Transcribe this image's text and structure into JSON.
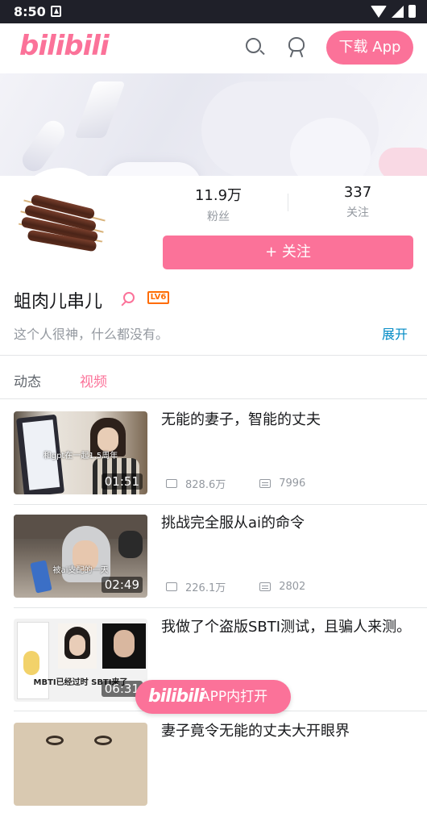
{
  "status_bar": {
    "time": "8:50"
  },
  "header": {
    "logo": "bilibili",
    "download_label": "下载 App"
  },
  "profile": {
    "followers_value": "11.9万",
    "followers_label": "粉丝",
    "following_value": "337",
    "following_label": "关注",
    "follow_button": "+ 关注",
    "name": "蛆肉儿串儿",
    "level": "LV6",
    "sign": "这个人很神，什么都没有。",
    "expand": "展开"
  },
  "tabs": [
    {
      "label": "动态"
    },
    {
      "label": "视频"
    }
  ],
  "active_tab": "视频",
  "videos": [
    {
      "title": "无能的妻子，智能的丈夫",
      "duration": "01:51",
      "views": "828.6万",
      "danmaku": "7996",
      "caption": "和gpt在一起1.5周年"
    },
    {
      "title": "挑战完全服从ai的命令",
      "duration": "02:49",
      "views": "226.1万",
      "danmaku": "2802",
      "caption": "被ai支配的一天"
    },
    {
      "title": "我做了个盗版SBTI测试，且骗人来测。",
      "duration": "06:31",
      "caption": "MBTI已经过时 SBTI来了"
    },
    {
      "title": "妻子竟令无能的丈夫大开眼界"
    }
  ],
  "app_open": {
    "logo": "bilibili",
    "label": "APP内打开"
  },
  "colors": {
    "brand": "#fb7299",
    "link": "#008ac5"
  }
}
